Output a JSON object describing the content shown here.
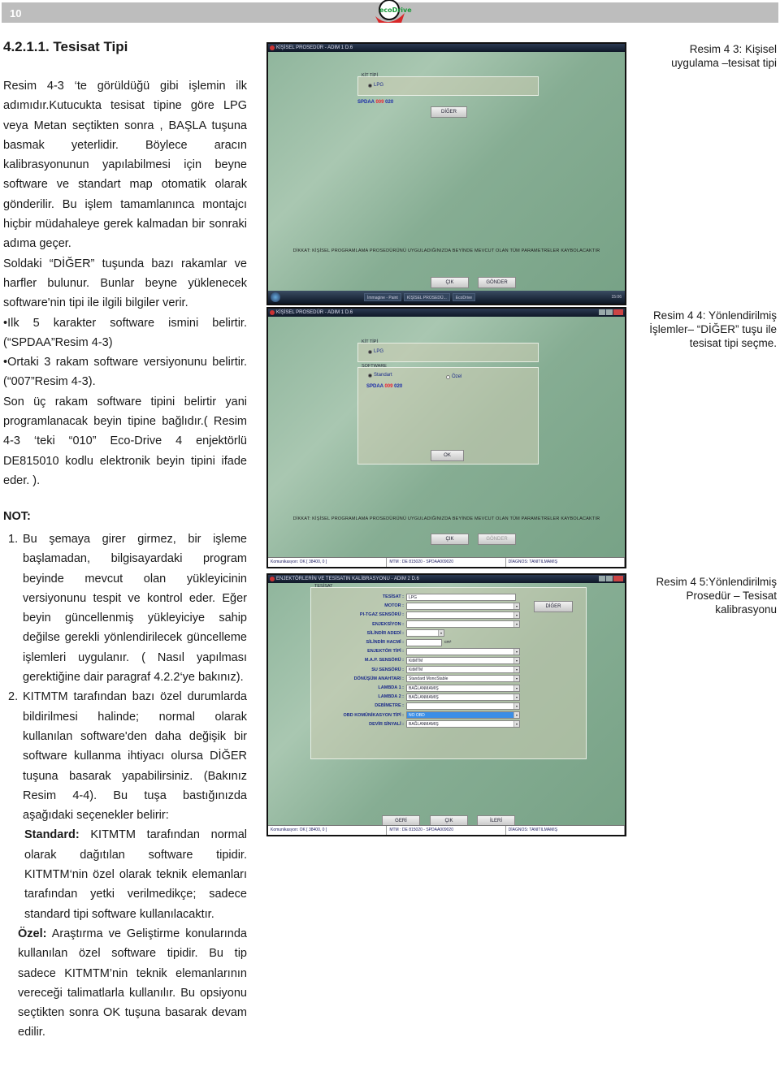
{
  "header": {
    "page_number": "10",
    "logo_text": "ecoDrive"
  },
  "section": {
    "title": "4.2.1.1. Tesisat Tipi",
    "paragraphs": [
      "Resim 4-3 ‘te görüldüğü gibi işlemin ilk adımıdır.Kutucukta tesisat tipine göre LPG veya Metan seçtikten sonra , BAŞLA tuşuna basmak yeterlidir. Böylece aracın kalibrasyonunun yapılabilmesi için beyne software ve standart map otomatik olarak gönderilir. Bu işlem tamamlanınca montajcı hiçbir müdahaleye gerek kalmadan bir sonraki adıma geçer.",
      "Soldaki “DİĞER” tuşunda bazı rakamlar ve harfler bulunur. Bunlar beyne yüklenecek software'nin tipi ile ilgili bilgiler verir.",
      "Ilk 5 karakter software ismini belirtir. (“SPDAA”Resim 4-3)",
      "Ortaki 3 rakam software versiyonunu belirtir. (“007”Resim 4-3).",
      "Son üç rakam software tipini belirtir yani programlanacak beyin tipine bağlıdır.( Resim 4-3 ‘teki “010” Eco-Drive 4 enjektörlü DE815010 kodlu elektronik beyin tipini ifade eder. )."
    ]
  },
  "note": {
    "title": "NOT:",
    "items": [
      {
        "num": "1.",
        "text": "Bu şemaya girer girmez, bir işleme başlamadan, bilgisayardaki program beyinde mevcut olan yükleyicinin versiyonunu tespit ve kontrol eder. Eğer beyin güncellenmiş yükleyiciye sahip değilse gerekli yönlendirilecek güncelleme işlemleri uygulanır. ( Nasıl yapılması gerektiğine dair  paragraf 4.2.2‘ye bakınız)."
      },
      {
        "num": "2.",
        "text": "KITMTM tarafından bazı özel durumlarda bildirilmesi halinde; normal olarak kullanılan software'den daha değişik bir software kullanma ihtiyacı olursa DİĞER tuşuna basarak yapabilirsiniz. (Bakınız Resim 4-4).  Bu tuşa bastığınızda aşağıdaki seçenekler belirir:"
      }
    ],
    "options": [
      {
        "term": "Standard:",
        "text": " KITMTM tarafından normal olarak dağıtılan software tipidir. KITMTM‘nin özel olarak teknik elemanları tarafından yetki verilmedikçe; sadece standard tipi software kullanılacaktır."
      },
      {
        "term": "Özel:",
        "text": " Araştırma ve Geliştirme konularında kullanılan özel software tipidir. Bu tip sadece KITMTM’nin teknik elemanlarının vereceği talimatlarla kullanılır. Bu opsiyonu seçtikten sonra  OK tuşuna basarak devam edilir."
      }
    ]
  },
  "figures": [
    {
      "caption": "Resim 4 3: Kişisel uygulama –tesisat tipi",
      "window_title": "KİŞİSEL PROSEDÜR - ADIM 1 D.6",
      "group_label": "KİT TİPİ",
      "radio_label": "LPG",
      "code_prefix": "SPDAA",
      "code_mid": "009",
      "code_suffix": "020",
      "other_button": "DİĞER",
      "warning": "DİKKAT: KİŞİSEL PROGRAMLAMA PROSEDÜRÜNÜ UYGULADIĞINIZDA BEYİNDE MEVCUT OLAN TÜM PARAMETRELER KAYBOLACAKTIR",
      "exit_button": "ÇIK",
      "send_button": "GÖNDER",
      "taskbar_items": [
        "İmmagine - Paint",
        "KİŞİSEL PROSEDÜ...",
        "EcoDrive"
      ],
      "clock": "15:06"
    },
    {
      "caption": "Resim 4 4: Yönlendirilmiş İşlemler– “DİĞER” tuşu ile tesisat tipi seçme.",
      "window_title": "KİŞİSEL PROSEDÜR - ADIM 1 D.6",
      "group_label": "KİT TİPİ",
      "radio_label": "LPG",
      "software_label": "SOFTWARE",
      "standard_label": "Standart",
      "ozel_label": "Özel",
      "code_prefix": "SPDAA",
      "code_mid": "009",
      "code_suffix": "020",
      "ok_button": "OK",
      "warning": "DİKKAT: KİŞİSEL PROGRAMLAMA PROSEDÜRÜNÜ UYGULADIĞINIZDA BEYİNDE MEVCUT OLAN TÜM PARAMETRELER KAYBOLACAKTIR",
      "exit_button": "ÇIK",
      "send_button": "GÖNDER",
      "status": [
        "Komunikasyon: OK [ 38400, 0 ]",
        "MTM : DE 815020 - SPDAA009020",
        "DİAGNOS: TANITILMAMIŞ"
      ]
    },
    {
      "caption": "Resim 4 5:Yönlendirilmiş Prosedür – Tesisat kalibrasyonu",
      "window_title": "ENJEKTÖRLERİN VE TESİSATIN KALİBRASYONU - ADIM 2 D.6",
      "group_label": "TESİSAT",
      "other_button": "DİĞER",
      "unit": "cm³",
      "fields": [
        {
          "label": "TESİSAT :",
          "value": "LPG",
          "type": "text"
        },
        {
          "label": "MOTOR :",
          "value": "",
          "type": "combo"
        },
        {
          "label": "PI-TGAZ SENSÖRÜ :",
          "value": "",
          "type": "combo"
        },
        {
          "label": "ENJEKSİYON :",
          "value": "",
          "type": "combo"
        },
        {
          "label": "SİLİNDİR ADEDİ :",
          "value": "",
          "type": "short"
        },
        {
          "label": "SİLİNDİR HACMİ :",
          "value": "",
          "type": "unit"
        },
        {
          "label": "ENJEKTÖR TİPİ :",
          "value": "",
          "type": "combo"
        },
        {
          "label": "M.A.P. SENSÖRÜ :",
          "value": "KitMTM",
          "type": "combo"
        },
        {
          "label": "SU SENSÖRÜ :",
          "value": "KitMTM",
          "type": "combo"
        },
        {
          "label": "DÖNÜŞÜM ANAHTARI :",
          "value": "Standard MonoStable",
          "type": "combo"
        },
        {
          "label": "LAMBDA 1 :",
          "value": "BAĞLANMAMIŞ",
          "type": "combo"
        },
        {
          "label": "LAMBDA 2 :",
          "value": "BAĞLANMAMIŞ",
          "type": "combo"
        },
        {
          "label": "DEBİMETRE :",
          "value": "",
          "type": "combo"
        },
        {
          "label": "OBD KOMÜNİKASYON TİPİ :",
          "value": "NO OBD",
          "type": "selected"
        },
        {
          "label": "DEVİR SİNYALİ :",
          "value": "BAĞLANMAMIŞ",
          "type": "combo"
        }
      ],
      "back_button": "GERİ",
      "exit_button": "ÇIK",
      "next_button": "İLERİ",
      "status": [
        "Komunikasyon: OK [ 38400, 0 ]",
        "MTM : DE 815020 - SPDAA009020",
        "DİAGNOS: TANITILMAMIŞ"
      ]
    }
  ]
}
